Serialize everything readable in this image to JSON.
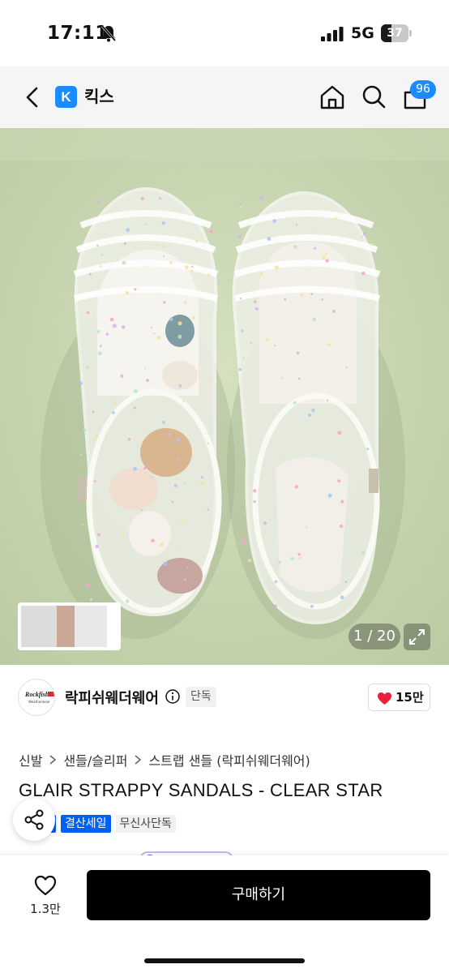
{
  "status_bar": {
    "time": "17:11",
    "network": "5G",
    "battery": "37",
    "battery_level": 0.37
  },
  "header": {
    "logo_letter": "K",
    "app_name": "킥스",
    "cart_count": "96"
  },
  "gallery": {
    "counter": "1 / 20"
  },
  "brand": {
    "name": "락피쉬웨더웨어",
    "exclusive_label": "단독",
    "likes": "15만",
    "logo_text": "Rockfish",
    "logo_subtext": "Weatherwear"
  },
  "breadcrumb": [
    "신발",
    "샌들/슬리퍼",
    "스트랩 샌들 (락피쉬웨더웨어)"
  ],
  "product": {
    "title": "GLAIR STRAPPY SANDALS - CLEAR STAR",
    "tags": [
      "결산세일",
      "무신사단독"
    ]
  },
  "bottom_bar": {
    "wishlist_count": "1.3만",
    "buy_label": "구매하기"
  },
  "colors": {
    "accent": "#1a8cff",
    "tag_blue": "#0060f0",
    "like_red": "#e8203a",
    "background_photo": "#c7d5b2"
  }
}
